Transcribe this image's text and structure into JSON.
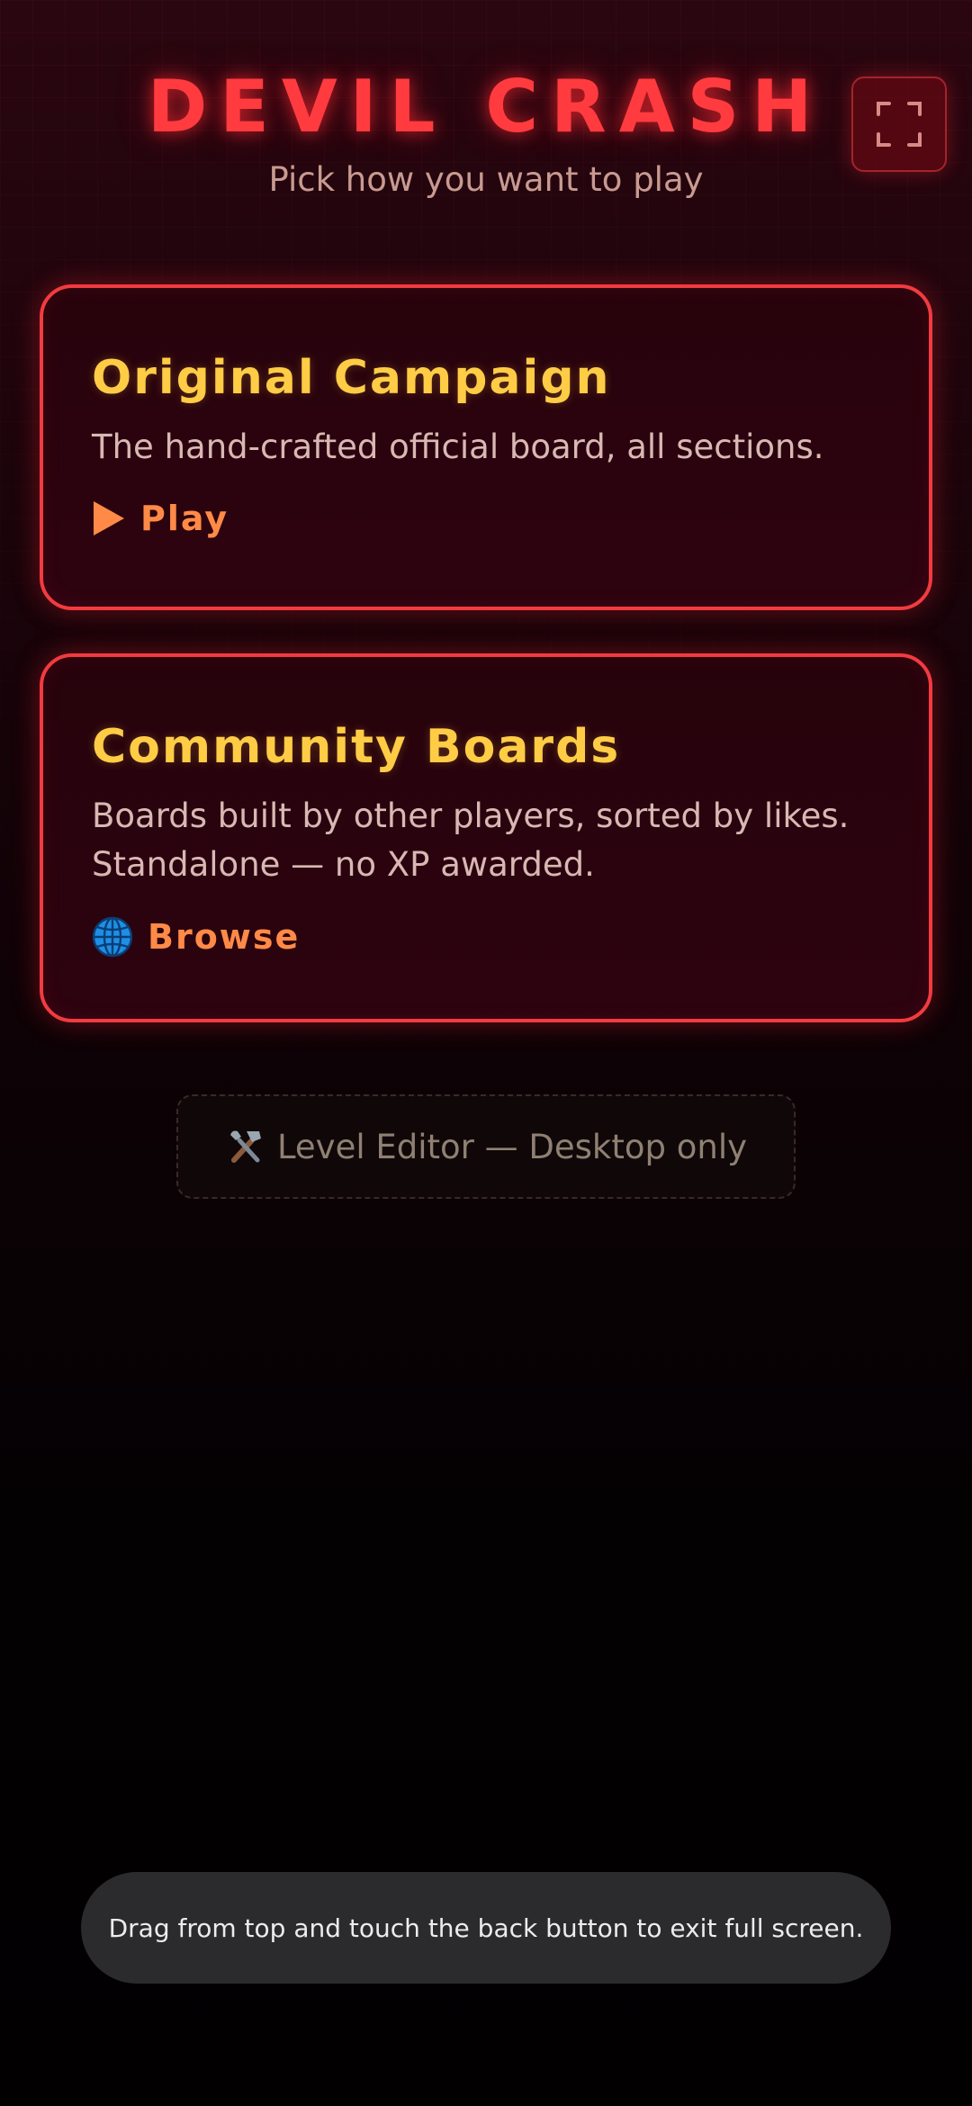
{
  "header": {
    "title": "DEVIL CRASH",
    "subtitle": "Pick how you want to play",
    "fullscreen_icon": "fullscreen-icon"
  },
  "cards": [
    {
      "title": "Original Campaign",
      "description": "The hand-crafted official board, all sections.",
      "action_icon": "play-icon",
      "action_label": "Play"
    },
    {
      "title": "Community Boards",
      "description_line1": "Boards built by other players, sorted by likes.",
      "description_line2": "Standalone — no XP awarded.",
      "action_icon": "globe-icon",
      "action_label": "Browse"
    }
  ],
  "editor": {
    "icon": "tools-icon",
    "label": "Level Editor — Desktop only"
  },
  "toast": {
    "text": "Drag from top and touch the back button to exit full screen."
  },
  "colors": {
    "title_red": "#ff3b3f",
    "card_border": "#f23b40",
    "card_title_yellow": "#ffcc45",
    "action_orange": "#ff8a47",
    "background_top": "#2a0610",
    "background_bottom": "#020001"
  }
}
